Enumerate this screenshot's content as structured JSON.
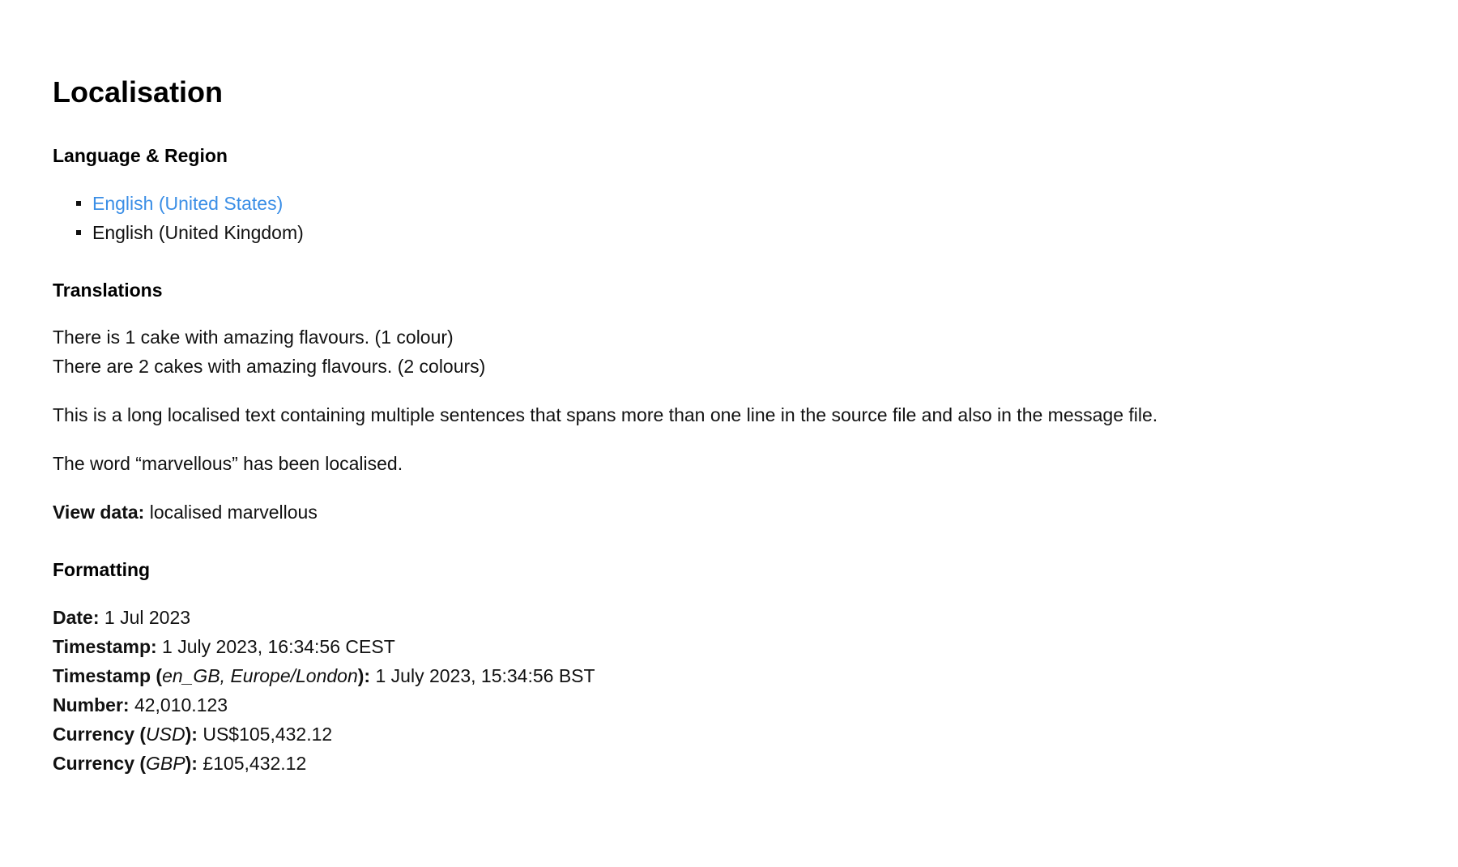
{
  "page": {
    "title": "Localisation"
  },
  "language_region": {
    "heading": "Language & Region",
    "items": [
      {
        "label": "English (United States)",
        "link": true
      },
      {
        "label": "English (United Kingdom)",
        "link": false
      }
    ]
  },
  "translations": {
    "heading": "Translations",
    "line_singular": "There is 1 cake with amazing flavours. (1 colour)",
    "line_plural": "There are 2 cakes with amazing flavours. (2 colours)",
    "long_text": "This is a long localised text containing multiple sentences that spans more than one line in the source file and also in the message file.",
    "word_text": "The word “marvellous” has been localised.",
    "view_data_label": "View data:",
    "view_data_value": " localised marvellous"
  },
  "formatting": {
    "heading": "Formatting",
    "date_label": "Date:",
    "date_value": " 1 Jul 2023",
    "timestamp_label": "Timestamp:",
    "timestamp_value": " 1 July 2023, 16:34:56 CEST",
    "timestamp_gb_label_pre": "Timestamp (",
    "timestamp_gb_arg": "en_GB, Europe/London",
    "timestamp_gb_label_post": "):",
    "timestamp_gb_value": " 1 July 2023, 15:34:56 BST",
    "number_label": "Number:",
    "number_value": " 42,010.123",
    "currency_usd_label_pre": "Currency (",
    "currency_usd_arg": "USD",
    "currency_usd_label_post": "):",
    "currency_usd_value": " US$105,432.12",
    "currency_gbp_label_pre": "Currency (",
    "currency_gbp_arg": "GBP",
    "currency_gbp_label_post": "):",
    "currency_gbp_value": " £105,432.12"
  },
  "colors": {
    "link": "#3a8ee6",
    "text": "#111111",
    "background": "#ffffff"
  }
}
